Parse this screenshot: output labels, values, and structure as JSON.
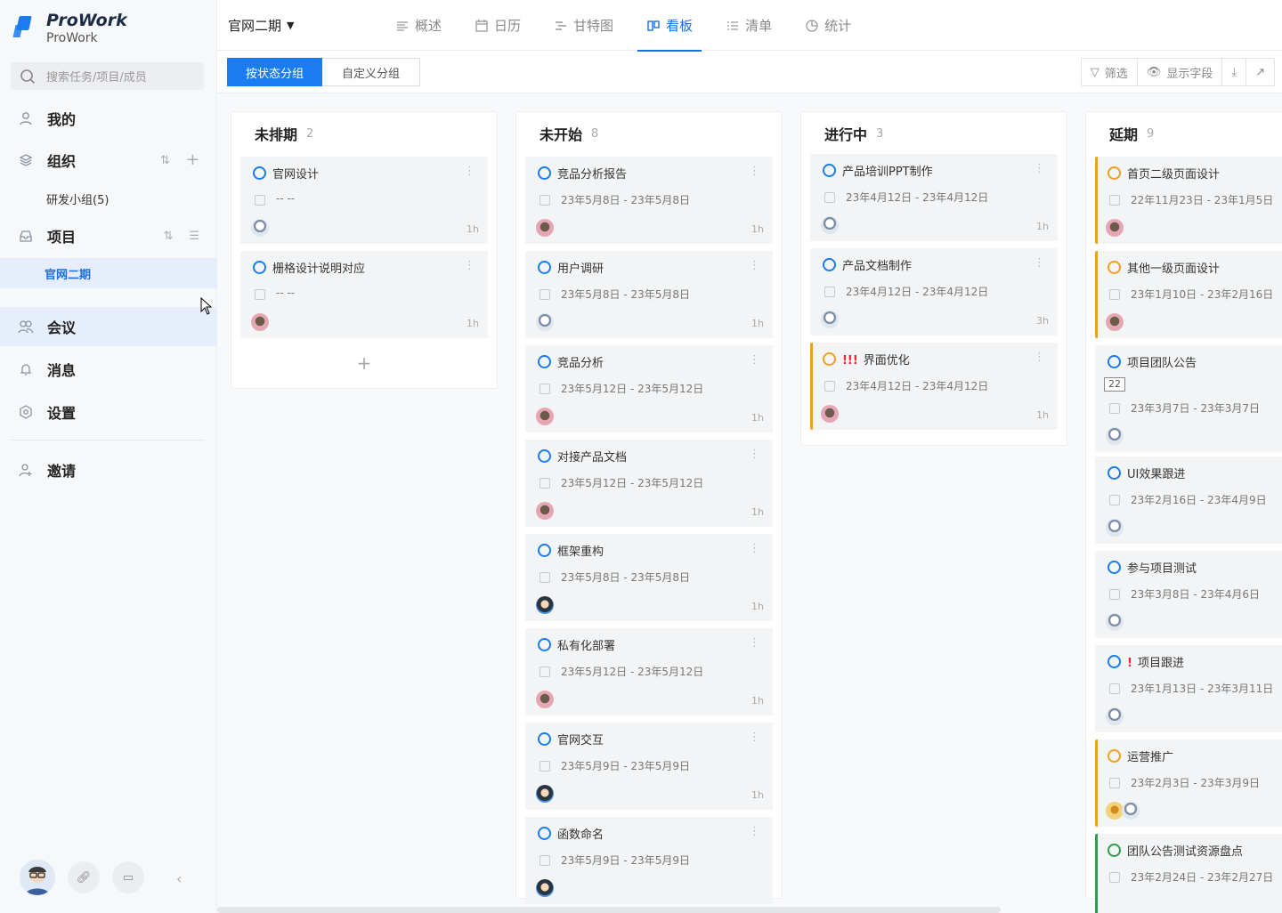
{
  "app": {
    "name": "ProWork",
    "sub": "ProWork"
  },
  "search": {
    "placeholder": "搜索任务/项目/成员"
  },
  "sidebar": {
    "my": "我的",
    "org": "组织",
    "org_sub": "研发小组(5)",
    "project": "项目",
    "project_sub": "官网二期",
    "meeting": "会议",
    "message": "消息",
    "settings": "设置",
    "invite": "邀请"
  },
  "topbar": {
    "project": "官网二期",
    "tabs": [
      "概述",
      "日历",
      "甘特图",
      "看板",
      "清单",
      "统计"
    ],
    "active_tab": "看板"
  },
  "toolbar": {
    "group_by_status": "按状态分组",
    "custom_group": "自定义分组",
    "filter": "筛选",
    "show_fields": "显示字段"
  },
  "columns": [
    {
      "title": "未排期",
      "count": "2",
      "cards": [
        {
          "title": "官网设计",
          "dates": "-- --",
          "dur": "1h",
          "avatar": "light"
        },
        {
          "title": "栅格设计说明对应",
          "dates": "-- --",
          "dur": "1h",
          "avatar": "pink"
        }
      ]
    },
    {
      "title": "未开始",
      "count": "8",
      "cards": [
        {
          "title": "竞品分析报告",
          "dates": "23年5月8日 - 23年5月8日",
          "dur": "1h",
          "avatar": "pink"
        },
        {
          "title": "用户调研",
          "dates": "23年5月8日 - 23年5月8日",
          "dur": "1h",
          "avatar": "light"
        },
        {
          "title": "竞品分析",
          "dates": "23年5月12日 - 23年5月12日",
          "dur": "1h",
          "avatar": "pink"
        },
        {
          "title": "对接产品文档",
          "dates": "23年5月12日 - 23年5月12日",
          "dur": "1h",
          "avatar": "pink"
        },
        {
          "title": "框架重构",
          "dates": "23年5月8日 - 23年5月8日",
          "dur": "1h",
          "avatar": "dark"
        },
        {
          "title": "私有化部署",
          "dates": "23年5月12日 - 23年5月12日",
          "dur": "1h",
          "avatar": "pink"
        },
        {
          "title": "官网交互",
          "dates": "23年5月9日 - 23年5月9日",
          "dur": "1h",
          "avatar": "dark"
        },
        {
          "title": "函数命名",
          "dates": "23年5月9日 - 23年5月9日",
          "dur": "",
          "avatar": "dark"
        }
      ]
    },
    {
      "title": "进行中",
      "count": "3",
      "cards": [
        {
          "title": "产品培训PPT制作",
          "dates": "23年4月12日 - 23年4月12日",
          "dur": "1h",
          "avatar": "light"
        },
        {
          "title": "产品文档制作",
          "dates": "23年4月12日 - 23年4月12日",
          "dur": "3h",
          "avatar": "light"
        },
        {
          "title": "界面优化",
          "bang": "!!!",
          "dates": "23年4月12日 - 23年4月12日",
          "dur": "1h",
          "avatar": "pink",
          "style": "orange"
        }
      ]
    },
    {
      "title": "延期",
      "count": "9",
      "cards": [
        {
          "title": "首页二级页面设计",
          "dates": "22年11月23日 - 23年1月5日",
          "avatar": "pink",
          "style": "orange"
        },
        {
          "title": "其他一级页面设计",
          "dates": "23年1月10日 - 23年2月16日",
          "avatar": "pink",
          "style": "orange"
        },
        {
          "title": "项目团队公告",
          "tag": "22",
          "dates": "23年3月7日 - 23年3月7日",
          "avatar": "light"
        },
        {
          "title": "UI效果跟进",
          "dates": "23年2月16日 - 23年4月9日",
          "avatar": "light"
        },
        {
          "title": "参与项目测试",
          "dates": "23年3月8日 - 23年4月6日",
          "avatar": "light"
        },
        {
          "title": "项目跟进",
          "bang": "!",
          "dates": "23年1月13日 - 23年3月11日",
          "avatar": "light"
        },
        {
          "title": "运营推广",
          "dates": "23年2月3日 - 23年3月9日",
          "avatar": "yellow",
          "style": "orange"
        },
        {
          "title": "团队公告测试资源盘点",
          "dates": "23年2月24日 - 23年2月27日",
          "avatar": "",
          "style": "green"
        }
      ]
    }
  ]
}
